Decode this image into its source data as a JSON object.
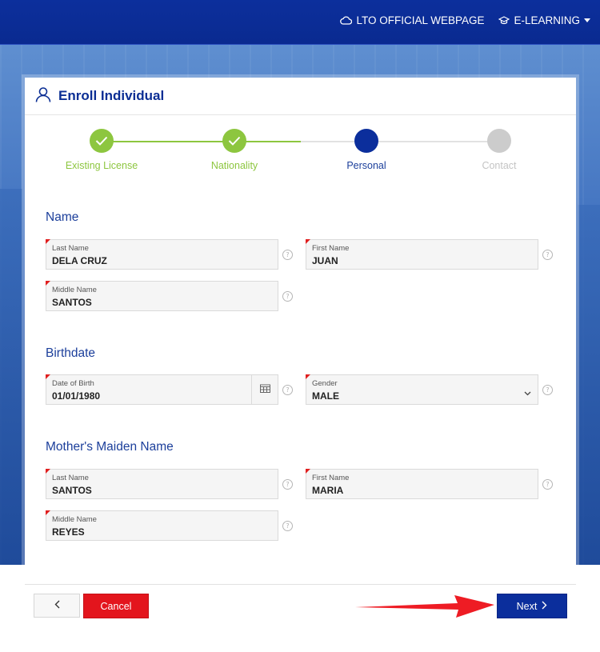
{
  "topnav": {
    "official_webpage": "LTO OFFICIAL WEBPAGE",
    "elearning": "E-LEARNING"
  },
  "card": {
    "title": "Enroll Individual",
    "title_icon": "user-icon"
  },
  "stepper": {
    "steps": [
      {
        "label": "Existing License",
        "status": "completed"
      },
      {
        "label": "Nationality",
        "status": "completed"
      },
      {
        "label": "Personal",
        "status": "current"
      },
      {
        "label": "Contact",
        "status": "upcoming"
      }
    ],
    "colors": {
      "completed": "#8dc63f",
      "current": "#0b2e9c",
      "upcoming": "#cccccc"
    }
  },
  "sections": {
    "name": {
      "title": "Name",
      "last_name": {
        "label": "Last Name",
        "value": "DELA CRUZ"
      },
      "first_name": {
        "label": "First Name",
        "value": "JUAN"
      },
      "middle_name": {
        "label": "Middle Name",
        "value": "SANTOS"
      }
    },
    "birthdate": {
      "title": "Birthdate",
      "date_of_birth": {
        "label": "Date of Birth",
        "value": "01/01/1980"
      },
      "gender": {
        "label": "Gender",
        "value": "MALE"
      }
    },
    "mother": {
      "title": "Mother's Maiden Name",
      "last_name": {
        "label": "Last Name",
        "value": "SANTOS"
      },
      "first_name": {
        "label": "First Name",
        "value": "MARIA"
      },
      "middle_name": {
        "label": "Middle Name",
        "value": "REYES"
      }
    }
  },
  "help_glyph": "?",
  "footer": {
    "cancel_label": "Cancel",
    "next_label": "Next"
  },
  "colors": {
    "brand_blue": "#0b2e9c",
    "cancel_red": "#e3151d",
    "required_marker": "#e01e1e",
    "annotation_arrow": "#ee1c24"
  }
}
